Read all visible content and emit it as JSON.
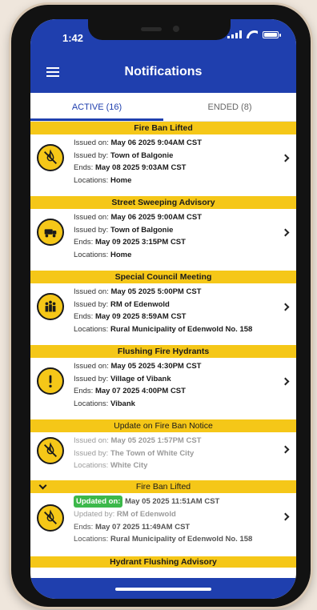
{
  "status": {
    "time": "1:42"
  },
  "header": {
    "title": "Notifications"
  },
  "tabs": [
    {
      "label": "ACTIVE (16)",
      "active": true
    },
    {
      "label": "ENDED (8)",
      "active": false
    }
  ],
  "labels": {
    "issued_on": "Issued on:",
    "issued_by": "Issued by:",
    "ends": "Ends:",
    "locations": "Locations:",
    "updated_by": "Updated by:",
    "updated_on": "Updated on:"
  },
  "notifications": [
    {
      "title": "Fire Ban Lifted",
      "icon": "no-fire-icon",
      "issued_on": "May 06 2025 9:04AM CST",
      "issued_by": "Town of Balgonie",
      "ends": "May 08 2025 9:03AM CST",
      "locations": "Home"
    },
    {
      "title": "Street Sweeping Advisory",
      "icon": "street-sweeper-icon",
      "issued_on": "May 06 2025 9:00AM CST",
      "issued_by": "Town of Balgonie",
      "ends": "May 09 2025 3:15PM CST",
      "locations": "Home"
    },
    {
      "title": "Special Council Meeting",
      "icon": "people-meeting-icon",
      "issued_on": "May 05 2025 5:00PM CST",
      "issued_by": "RM of Edenwold",
      "ends": "May 09 2025 8:59AM CST",
      "locations": "Rural Municipality of Edenwold No. 158"
    },
    {
      "title": "Flushing Fire Hydrants",
      "icon": "exclamation-icon",
      "issued_on": "May 05 2025 4:30PM CST",
      "issued_by": "Village of Vibank",
      "ends": "May 07 2025 4:00PM CST",
      "locations": "Vibank"
    },
    {
      "title": "Update on Fire Ban Notice",
      "icon": "no-fire-icon",
      "issued_on": "May 05 2025 1:57PM CST",
      "issued_by": "The Town of White City",
      "locations": "White City"
    },
    {
      "title": "Fire Ban Lifted",
      "icon": "no-fire-icon",
      "updated_on": "May 05 2025 11:51AM CST",
      "updated_by": "RM of Edenwold",
      "ends": "May 07 2025 11:49AM CST",
      "locations": "Rural Municipality of Edenwold No. 158"
    },
    {
      "title": "Hydrant Flushing Advisory"
    }
  ]
}
